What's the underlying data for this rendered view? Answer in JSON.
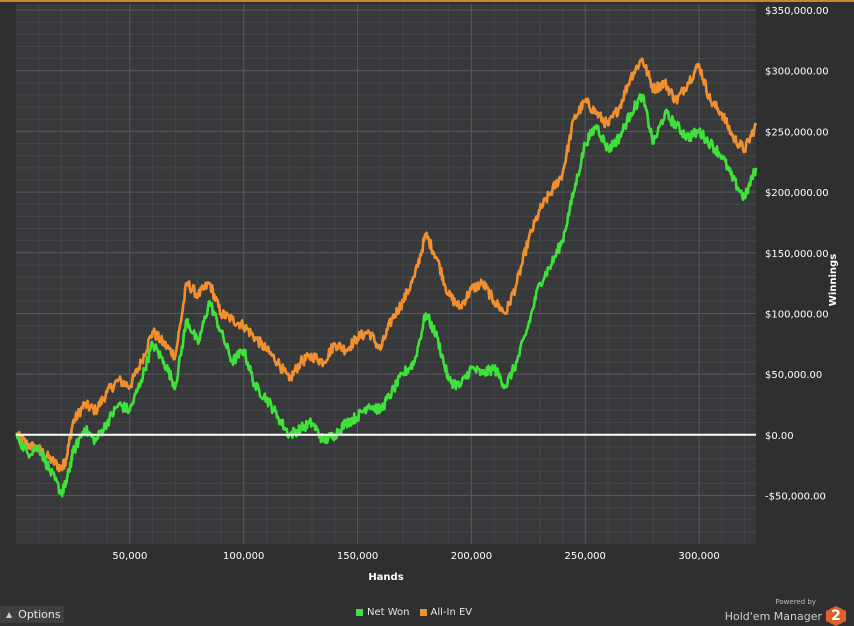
{
  "chart_data": {
    "type": "line",
    "xlabel": "Hands",
    "ylabel": "Winnings",
    "xlim": [
      0,
      325000
    ],
    "ylim": [
      -90000,
      355000
    ],
    "x_ticks": [
      50000,
      100000,
      150000,
      200000,
      250000,
      300000
    ],
    "x_tick_labels": [
      "50,000",
      "100,000",
      "150,000",
      "200,000",
      "250,000",
      "300,000"
    ],
    "y_ticks": [
      -50000,
      0,
      50000,
      100000,
      150000,
      200000,
      250000,
      300000,
      350000
    ],
    "y_tick_labels": [
      "-$50,000.00",
      "$0.00",
      "$50,000.00",
      "$100,000.00",
      "$150,000.00",
      "$200,000.00",
      "$250,000.00",
      "$300,000.00",
      "$350,000.00"
    ],
    "grid": true,
    "legend_position": "bottom-center",
    "zero_line": true,
    "series": [
      {
        "name": "Net Won",
        "color": "#3ee23a",
        "points": [
          [
            0,
            0
          ],
          [
            5000,
            -15000
          ],
          [
            10000,
            -10000
          ],
          [
            15000,
            -30000
          ],
          [
            20000,
            -48000
          ],
          [
            22000,
            -40000
          ],
          [
            25000,
            -15000
          ],
          [
            30000,
            5000
          ],
          [
            35000,
            -5000
          ],
          [
            40000,
            10000
          ],
          [
            45000,
            25000
          ],
          [
            50000,
            20000
          ],
          [
            55000,
            45000
          ],
          [
            60000,
            75000
          ],
          [
            65000,
            60000
          ],
          [
            70000,
            40000
          ],
          [
            75000,
            95000
          ],
          [
            80000,
            75000
          ],
          [
            85000,
            110000
          ],
          [
            90000,
            85000
          ],
          [
            95000,
            60000
          ],
          [
            100000,
            70000
          ],
          [
            105000,
            40000
          ],
          [
            110000,
            30000
          ],
          [
            115000,
            15000
          ],
          [
            120000,
            0
          ],
          [
            125000,
            5000
          ],
          [
            130000,
            10000
          ],
          [
            135000,
            -5000
          ],
          [
            140000,
            0
          ],
          [
            145000,
            10000
          ],
          [
            150000,
            15000
          ],
          [
            155000,
            25000
          ],
          [
            160000,
            20000
          ],
          [
            165000,
            35000
          ],
          [
            170000,
            50000
          ],
          [
            175000,
            60000
          ],
          [
            180000,
            100000
          ],
          [
            185000,
            80000
          ],
          [
            190000,
            45000
          ],
          [
            195000,
            40000
          ],
          [
            200000,
            55000
          ],
          [
            205000,
            50000
          ],
          [
            210000,
            55000
          ],
          [
            215000,
            40000
          ],
          [
            220000,
            60000
          ],
          [
            225000,
            90000
          ],
          [
            230000,
            125000
          ],
          [
            235000,
            140000
          ],
          [
            240000,
            160000
          ],
          [
            245000,
            200000
          ],
          [
            250000,
            240000
          ],
          [
            255000,
            255000
          ],
          [
            260000,
            235000
          ],
          [
            265000,
            245000
          ],
          [
            270000,
            265000
          ],
          [
            275000,
            280000
          ],
          [
            280000,
            240000
          ],
          [
            285000,
            265000
          ],
          [
            290000,
            255000
          ],
          [
            295000,
            245000
          ],
          [
            300000,
            250000
          ],
          [
            305000,
            240000
          ],
          [
            310000,
            230000
          ],
          [
            315000,
            210000
          ],
          [
            320000,
            195000
          ],
          [
            325000,
            220000
          ]
        ]
      },
      {
        "name": "All-In EV",
        "color": "#f2902f",
        "points": [
          [
            0,
            0
          ],
          [
            5000,
            -8000
          ],
          [
            10000,
            -12000
          ],
          [
            15000,
            -20000
          ],
          [
            20000,
            -28000
          ],
          [
            22000,
            -20000
          ],
          [
            25000,
            10000
          ],
          [
            30000,
            25000
          ],
          [
            35000,
            20000
          ],
          [
            40000,
            35000
          ],
          [
            45000,
            45000
          ],
          [
            50000,
            40000
          ],
          [
            55000,
            60000
          ],
          [
            60000,
            85000
          ],
          [
            65000,
            75000
          ],
          [
            70000,
            65000
          ],
          [
            75000,
            125000
          ],
          [
            80000,
            115000
          ],
          [
            85000,
            125000
          ],
          [
            90000,
            100000
          ],
          [
            95000,
            95000
          ],
          [
            100000,
            90000
          ],
          [
            105000,
            80000
          ],
          [
            110000,
            70000
          ],
          [
            115000,
            60000
          ],
          [
            120000,
            45000
          ],
          [
            125000,
            60000
          ],
          [
            130000,
            65000
          ],
          [
            135000,
            60000
          ],
          [
            140000,
            75000
          ],
          [
            145000,
            70000
          ],
          [
            150000,
            80000
          ],
          [
            155000,
            85000
          ],
          [
            160000,
            70000
          ],
          [
            165000,
            95000
          ],
          [
            170000,
            110000
          ],
          [
            175000,
            130000
          ],
          [
            180000,
            165000
          ],
          [
            185000,
            145000
          ],
          [
            190000,
            115000
          ],
          [
            195000,
            105000
          ],
          [
            200000,
            120000
          ],
          [
            205000,
            125000
          ],
          [
            210000,
            110000
          ],
          [
            215000,
            100000
          ],
          [
            220000,
            125000
          ],
          [
            225000,
            160000
          ],
          [
            230000,
            185000
          ],
          [
            235000,
            200000
          ],
          [
            240000,
            215000
          ],
          [
            245000,
            260000
          ],
          [
            250000,
            275000
          ],
          [
            255000,
            265000
          ],
          [
            260000,
            255000
          ],
          [
            265000,
            270000
          ],
          [
            270000,
            295000
          ],
          [
            275000,
            310000
          ],
          [
            280000,
            285000
          ],
          [
            285000,
            290000
          ],
          [
            290000,
            275000
          ],
          [
            295000,
            290000
          ],
          [
            300000,
            305000
          ],
          [
            305000,
            275000
          ],
          [
            310000,
            265000
          ],
          [
            315000,
            245000
          ],
          [
            320000,
            235000
          ],
          [
            325000,
            255000
          ]
        ]
      }
    ]
  },
  "ui": {
    "options_label": "Options",
    "powered_by": "Powered by",
    "brand_name": "Hold'em Manager",
    "brand_badge": "2"
  }
}
